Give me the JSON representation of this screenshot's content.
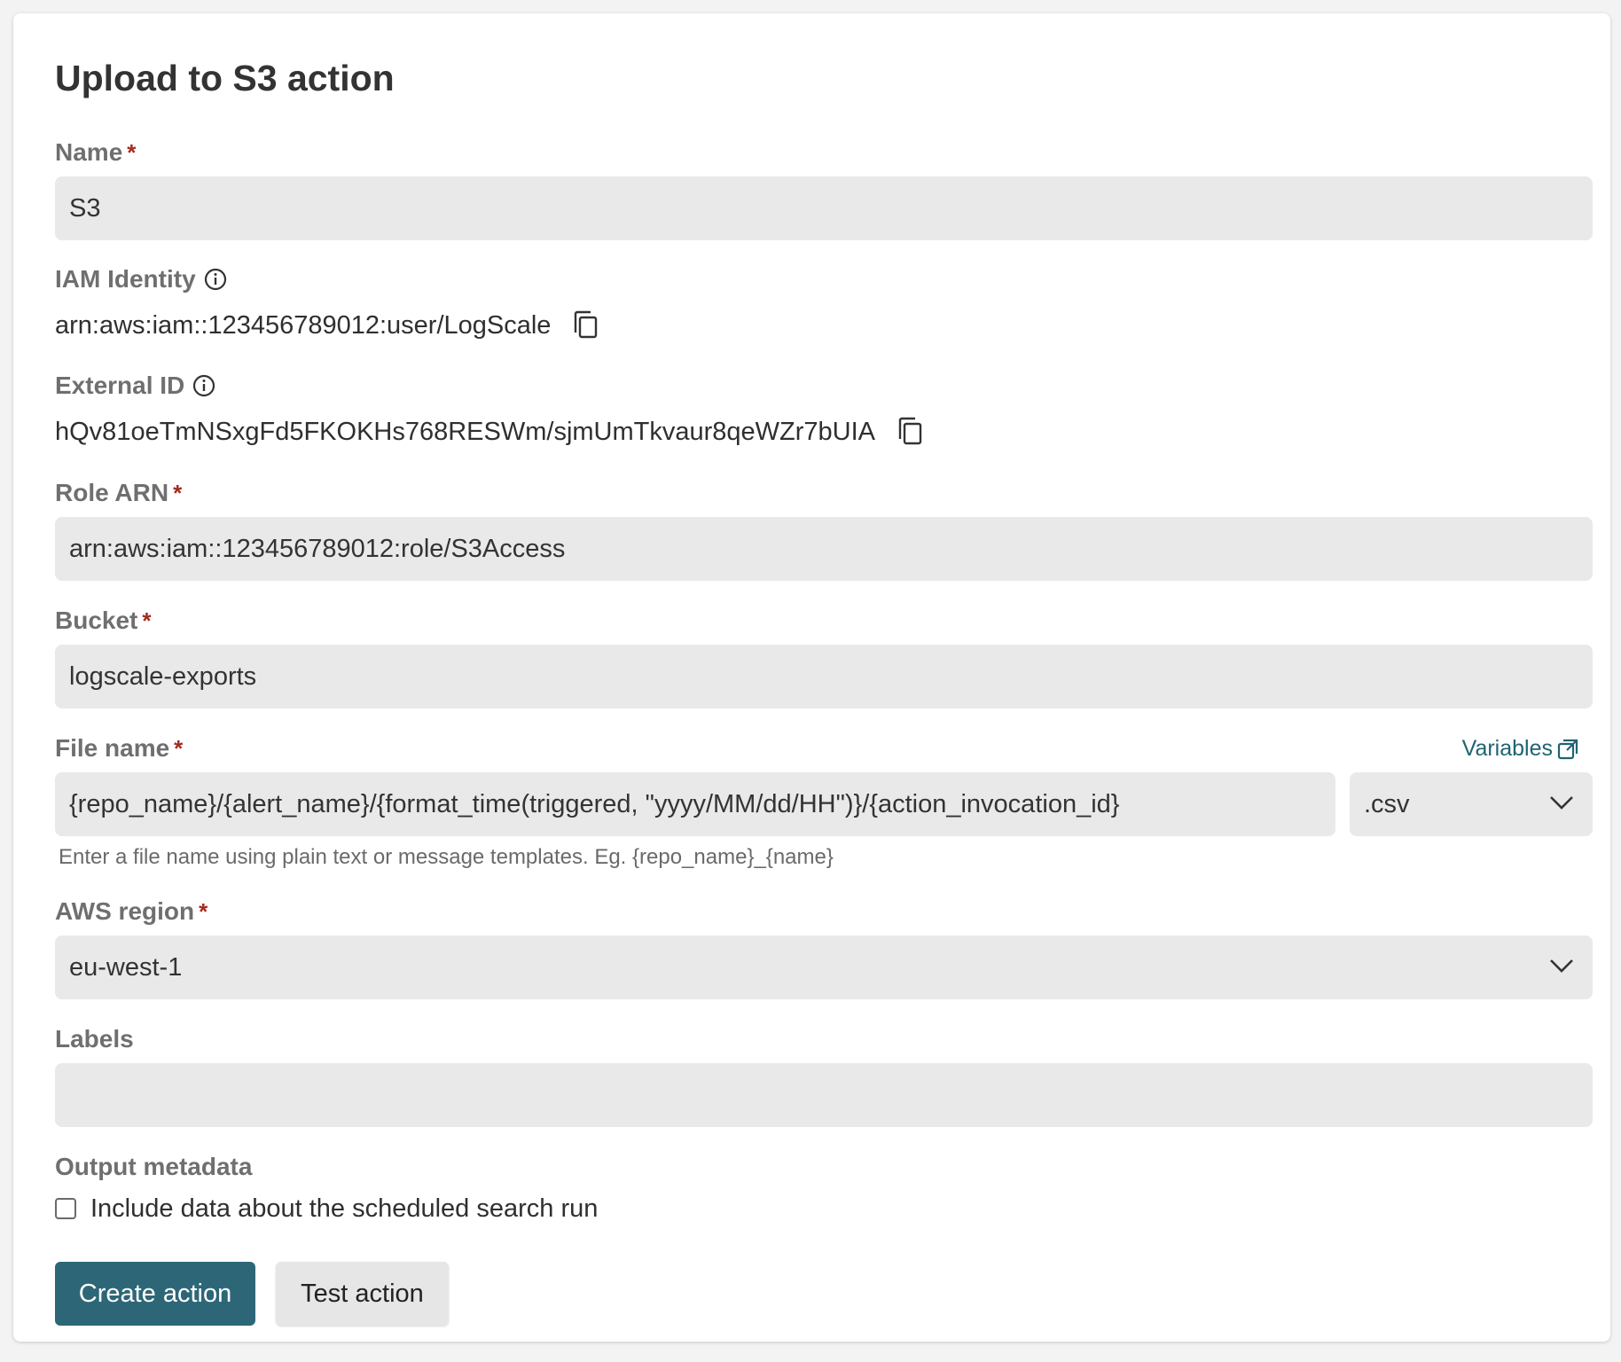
{
  "form": {
    "title": "Upload to S3 action",
    "required_marker": "*",
    "name": {
      "label": "Name",
      "value": "S3"
    },
    "iam_identity": {
      "label": "IAM Identity",
      "value": "arn:aws:iam::123456789012:user/LogScale"
    },
    "external_id": {
      "label": "External ID",
      "value": "hQv81oeTmNSxgFd5FKOKHs768RESWm/sjmUmTkvaur8qeWZr7bUIA"
    },
    "role_arn": {
      "label": "Role ARN",
      "value": "arn:aws:iam::123456789012:role/S3Access"
    },
    "bucket": {
      "label": "Bucket",
      "value": "logscale-exports"
    },
    "file_name": {
      "label": "File name",
      "variables_link": "Variables",
      "value": "{repo_name}/{alert_name}/{format_time(triggered, \"yyyy/MM/dd/HH\")}/{action_invocation_id}",
      "extension": ".csv",
      "help": "Enter a file name using plain text or message templates. Eg. {repo_name}_{name}"
    },
    "aws_region": {
      "label": "AWS region",
      "value": "eu-west-1"
    },
    "labels": {
      "label": "Labels",
      "value": ""
    },
    "output_metadata": {
      "label": "Output metadata",
      "checkbox_label": "Include data about the scheduled search run",
      "checked": false
    },
    "buttons": {
      "create": "Create action",
      "test": "Test action"
    }
  },
  "colors": {
    "primary": "#2d6777",
    "required": "#a52a1f",
    "link": "#1f6472",
    "input_bg": "#e9e9e9"
  },
  "icons": [
    "info-icon",
    "copy-icon",
    "chevron-down-icon",
    "external-link-icon"
  ]
}
